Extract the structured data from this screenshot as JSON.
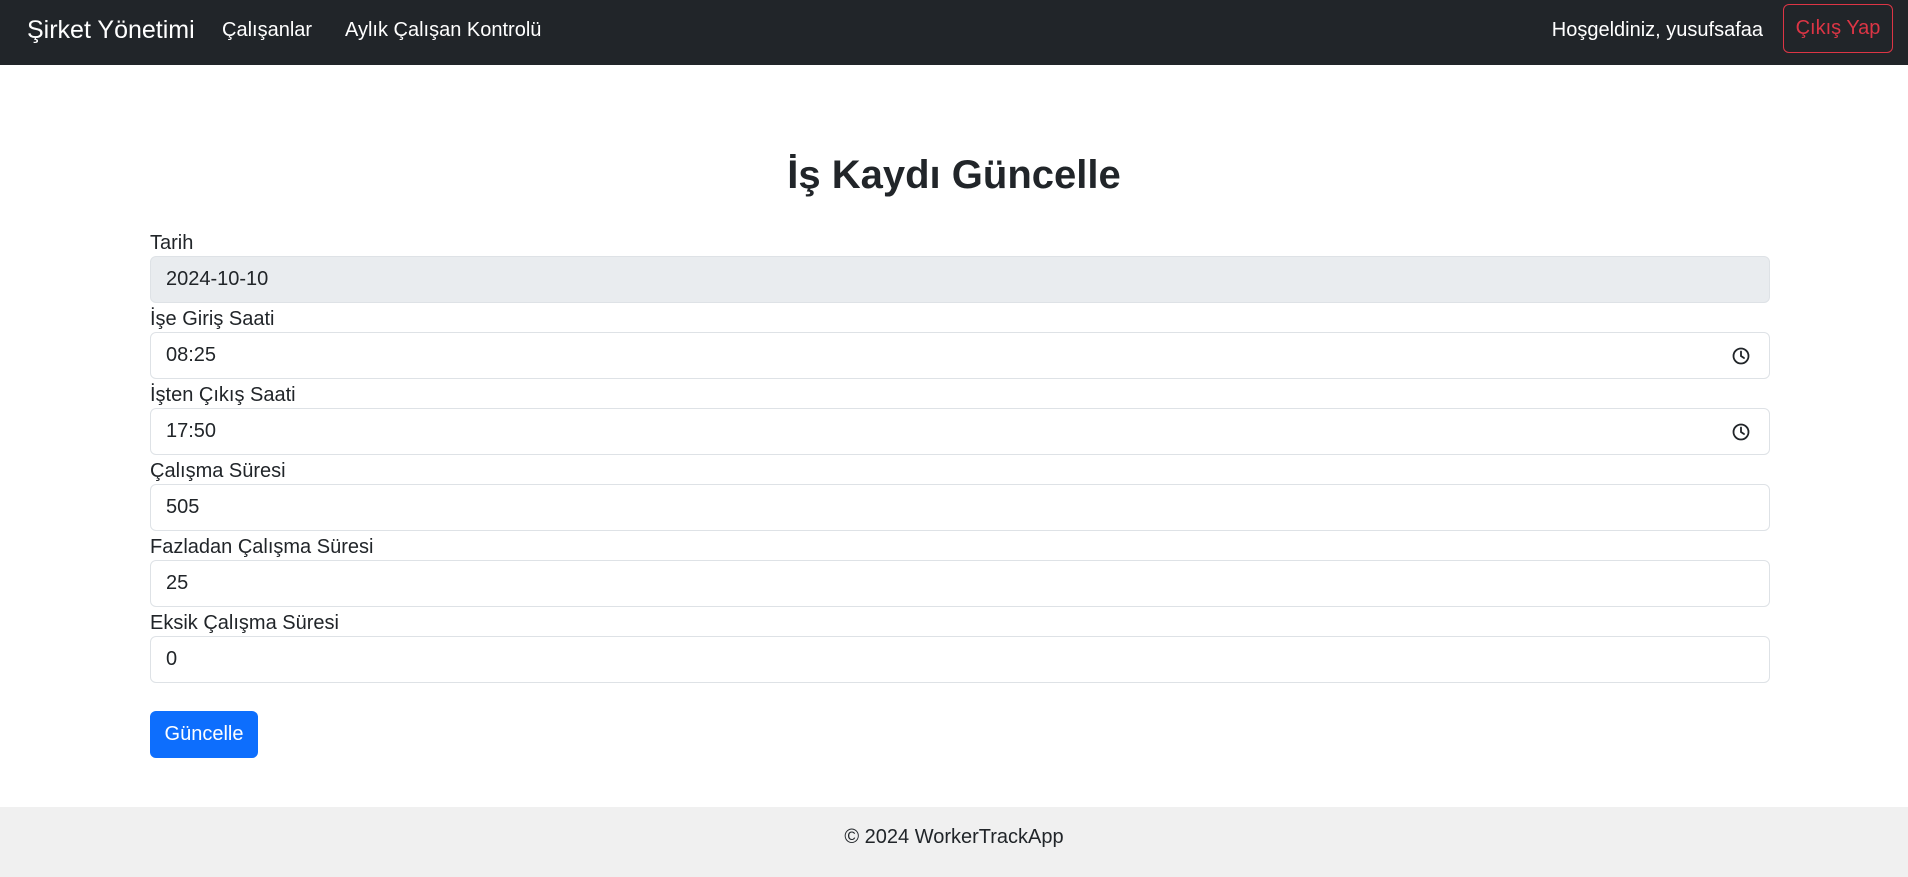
{
  "navbar": {
    "brand": "Şirket Yönetimi",
    "links": [
      "Çalışanlar",
      "Aylık Çalışan Kontrolü"
    ],
    "welcome": "Hoşgeldiniz, yusufsafaa",
    "logout_label": "Çıkış Yap"
  },
  "page": {
    "title": "İş Kaydı Güncelle"
  },
  "form": {
    "fields": [
      {
        "label": "Tarih",
        "value": "2024-10-10",
        "readonly": true
      },
      {
        "label": "İşe Giriş Saati",
        "value": "08:25",
        "icon": "clock-icon"
      },
      {
        "label": "İşten Çıkış Saati",
        "value": "17:50",
        "icon": "clock-icon"
      },
      {
        "label": "Çalışma Süresi",
        "value": "505"
      },
      {
        "label": "Fazladan Çalışma Süresi",
        "value": "25"
      },
      {
        "label": "Eksik Çalışma Süresi",
        "value": "0"
      }
    ],
    "submit_label": "Güncelle"
  },
  "footer": {
    "text": "© 2024 WorkerTrackApp"
  },
  "colors": {
    "navbar_bg": "#212529",
    "primary": "#0d6efd",
    "danger": "#dc3545",
    "readonly_bg": "#e9ecef",
    "footer_bg": "#f0f0f0"
  }
}
